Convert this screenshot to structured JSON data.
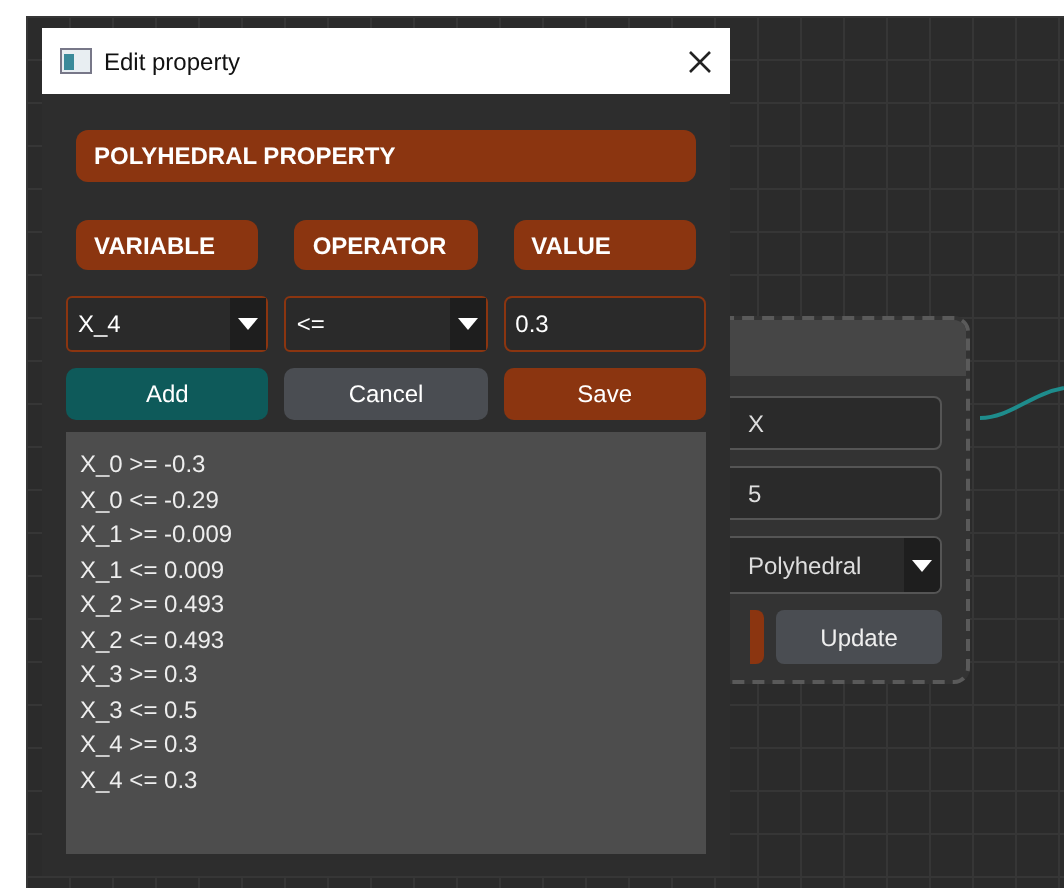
{
  "window": {
    "title": "Edit property"
  },
  "header": "POLYHEDRAL PROPERTY",
  "column_labels": [
    "VARIABLE",
    "OPERATOR",
    "VALUE"
  ],
  "variable_select": {
    "value": "X_4"
  },
  "operator_select": {
    "value": "<="
  },
  "value_field": {
    "value": "0.3"
  },
  "buttons": [
    {
      "label": "Add",
      "kind": "teal"
    },
    {
      "label": "Cancel",
      "kind": "gray"
    },
    {
      "label": "Save",
      "kind": "orange"
    }
  ],
  "constraints": [
    "X_0 >= -0.3",
    "X_0 <= -0.29",
    "X_1 >= -0.009",
    "X_1 <= 0.009",
    "X_2 >= 0.493",
    "X_2 <= 0.493",
    "X_3 >= 0.3",
    "X_3 <= 0.5",
    "X_4 >= 0.3",
    "X_4 <= 0.3"
  ],
  "node": {
    "name_field": {
      "value": "X"
    },
    "size_field": {
      "value": "5"
    },
    "type_select": {
      "value": "Polyhedral"
    },
    "update_button": "Update"
  }
}
